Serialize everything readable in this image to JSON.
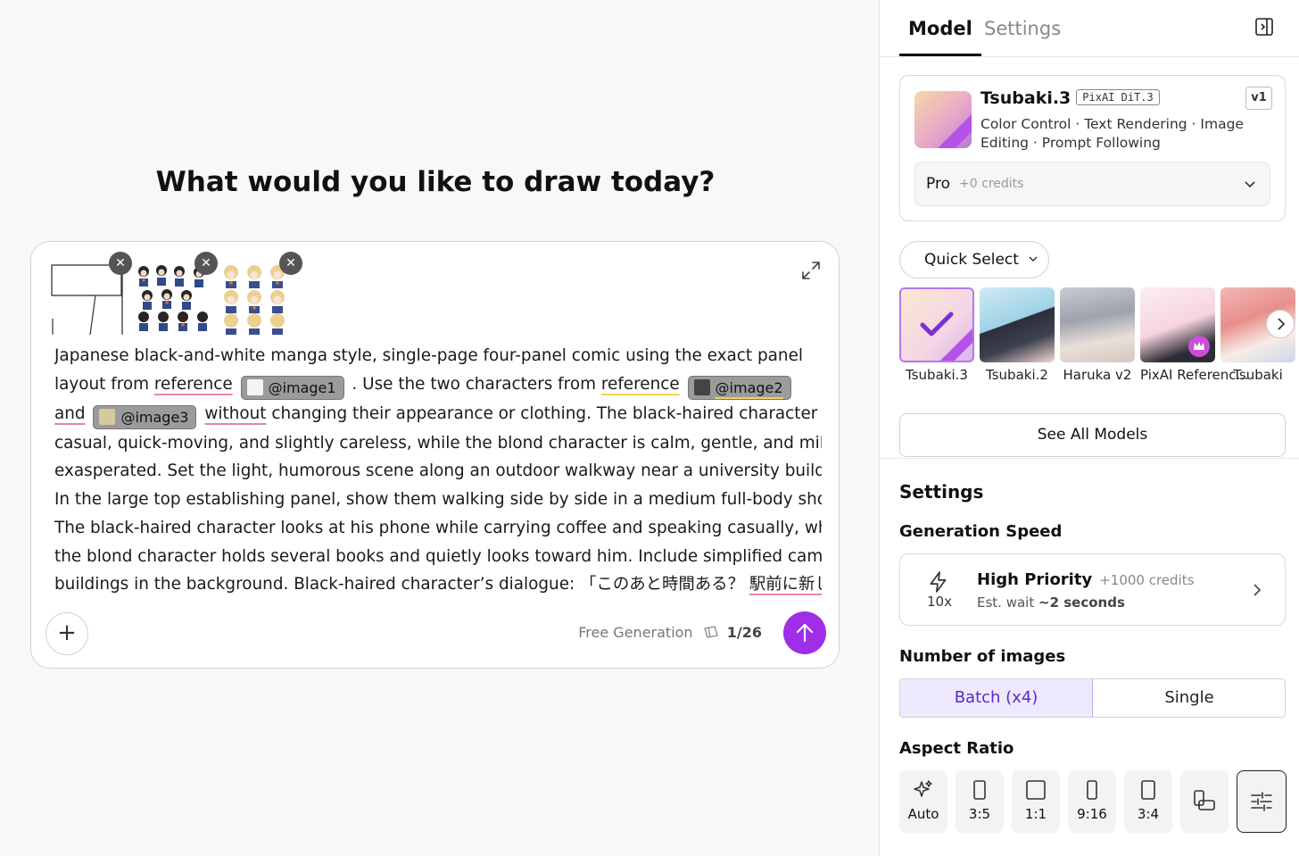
{
  "composer": {
    "heading": "What would you like to draw today?",
    "prompt": {
      "line1": "Japanese black-and-white manga style, single-page four-panel comic using the exact panel",
      "line2_a": "layout from ",
      "ref1": "reference",
      "chip1": "@image1",
      "line2_b": " . Use the two characters from ",
      "ref2": "reference",
      "chip2": "@image2",
      "and": "and",
      "chip3": "@image3",
      "without": "without",
      "line3_rest": " changing their appearance or clothing. The black-haired character is",
      "line4": "casual, quick-moving, and slightly careless, while the blond character is calm, gentle, and mildly",
      "line5": "exasperated. Set the light, humorous scene along an outdoor walkway near a university building.",
      "line6": "In the large top establishing panel, show them walking side by side in a medium full-body shot.",
      "line7": "The black-haired character looks at his phone while carrying coffee and speaking casually, while",
      "line8": "the blond character holds several books and quietly looks toward him. Include simplified campus",
      "line9_a": "buildings in the background. Black-haired character’s dialogue: 「このあと時間ある？ ",
      "line9_b": "駅前に新しい"
    },
    "free_generation_label": "Free Generation",
    "free_generation_count": "1/26",
    "remove_icon": "✕",
    "plus_icon": "+"
  },
  "panel": {
    "tabs": [
      "Model",
      "Settings"
    ],
    "model": {
      "name": "Tsubaki.3",
      "tag": "PixAI DiT.3",
      "version": "v1",
      "description": "Color Control · Text Rendering · Image Editing · Prompt Following",
      "tier_name": "Pro",
      "tier_credits": "+0 credits"
    },
    "quick_select_label": "Quick Select",
    "models": [
      {
        "label": "Tsubaki.3",
        "selected": true
      },
      {
        "label": "Tsubaki.2"
      },
      {
        "label": "Haruka v2"
      },
      {
        "label": "PixAI Referenc..."
      },
      {
        "label": "Tsubaki"
      }
    ],
    "see_all_label": "See All Models",
    "settings_title": "Settings",
    "gen_speed": {
      "title": "Generation Speed",
      "multiplier": "10x",
      "priority": "High Priority",
      "credits": "+1000 credits",
      "wait_prefix": "Est. wait ",
      "wait_value": "~2 seconds"
    },
    "num_images": {
      "title": "Number of images",
      "options": [
        "Batch (x4)",
        "Single"
      ],
      "selected": "Batch (x4)"
    },
    "aspect_ratio": {
      "title": "Aspect Ratio",
      "options": [
        "Auto",
        "3:5",
        "1:1",
        "9:16",
        "3:4"
      ]
    },
    "colors": {
      "accent": "#a02de8",
      "selected_bg": "#eee9ff"
    }
  }
}
